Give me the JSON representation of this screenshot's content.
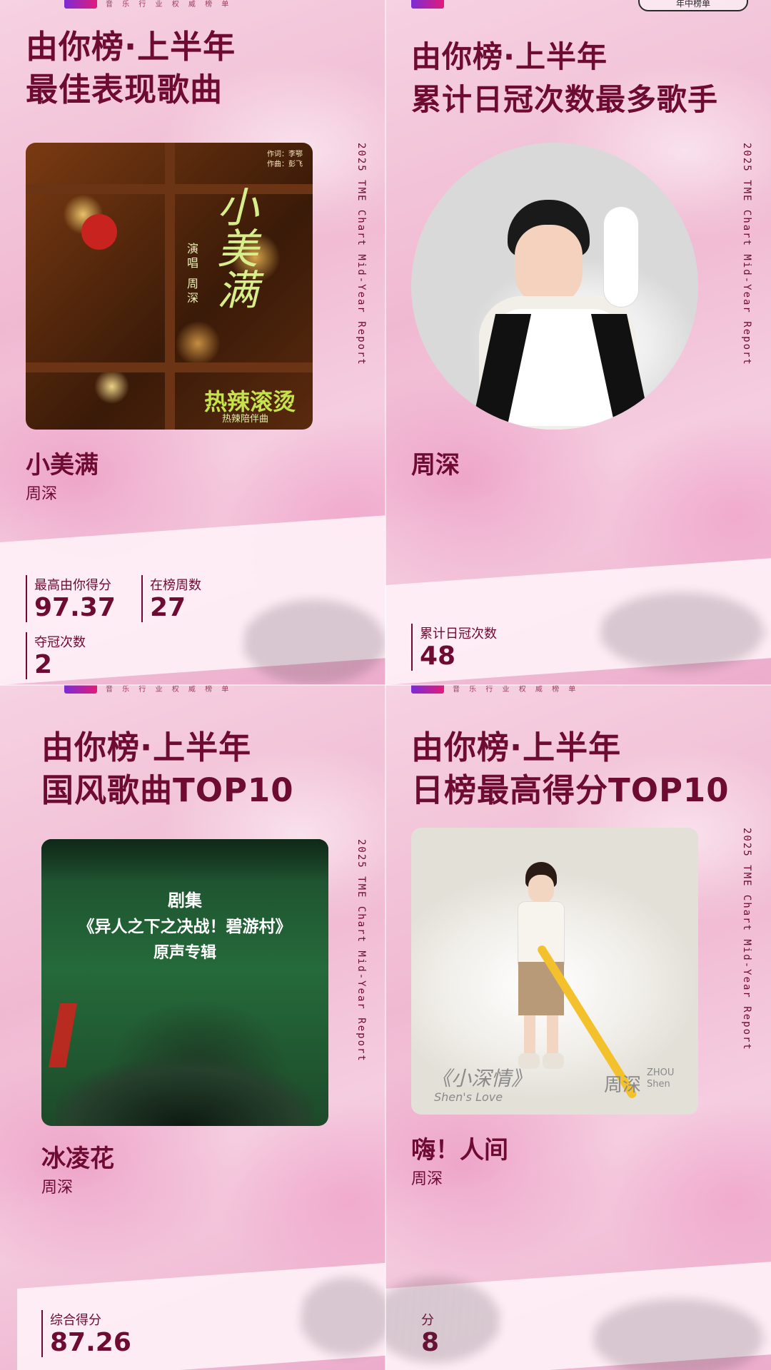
{
  "brand": {
    "tagline": "音 乐 行 业 权 威 榜 单",
    "badge": "年中榜单"
  },
  "vertical_text": "2025 TME Chart Mid-Year Report",
  "colors": {
    "title": "#6e0b33",
    "accent": "#e21b78"
  },
  "panels": [
    {
      "title_line1": "由你榜·上半年",
      "title_line2": "最佳表现歌曲",
      "cover": {
        "credits_1": "作词：李鄂",
        "credits_2": "作曲：彭飞",
        "art_title": "小美满",
        "singer_note": "演唱 周深",
        "drama": "热辣滚烫",
        "drama_sub": "热辣陪伴曲"
      },
      "song": "小美满",
      "artist": "周深",
      "stats": [
        {
          "label": "最高由你得分",
          "value": "97.37"
        },
        {
          "label": "在榜周数",
          "value": "27"
        },
        {
          "label": "夺冠次数",
          "value": "2"
        }
      ]
    },
    {
      "title_line1": "由你榜·上半年",
      "title_line2": "累计日冠次数最多歌手",
      "song": "周深",
      "stats": [
        {
          "label": "累计日冠次数",
          "value": "48"
        }
      ]
    },
    {
      "title_line1": "由你榜·上半年",
      "title_line2": "国风歌曲TOP10",
      "cover": {
        "line1": "剧集",
        "line2": "《异人之下之决战！碧游村》",
        "line3": "原声专辑"
      },
      "song": "冰凌花",
      "artist": "周深",
      "stats": [
        {
          "label": "综合得分",
          "value": "87.26"
        }
      ]
    },
    {
      "title_line1": "由你榜·上半年",
      "title_line2": "日榜最高得分TOP10",
      "cover": {
        "left_text": "《小深情》",
        "left_sub": "Shen's Love",
        "right_text": "周深",
        "right_sub": "ZHOU Shen"
      },
      "song": "嗨！人间",
      "artist": "周深",
      "stats": [
        {
          "label": "分",
          "value": "8"
        }
      ]
    }
  ]
}
